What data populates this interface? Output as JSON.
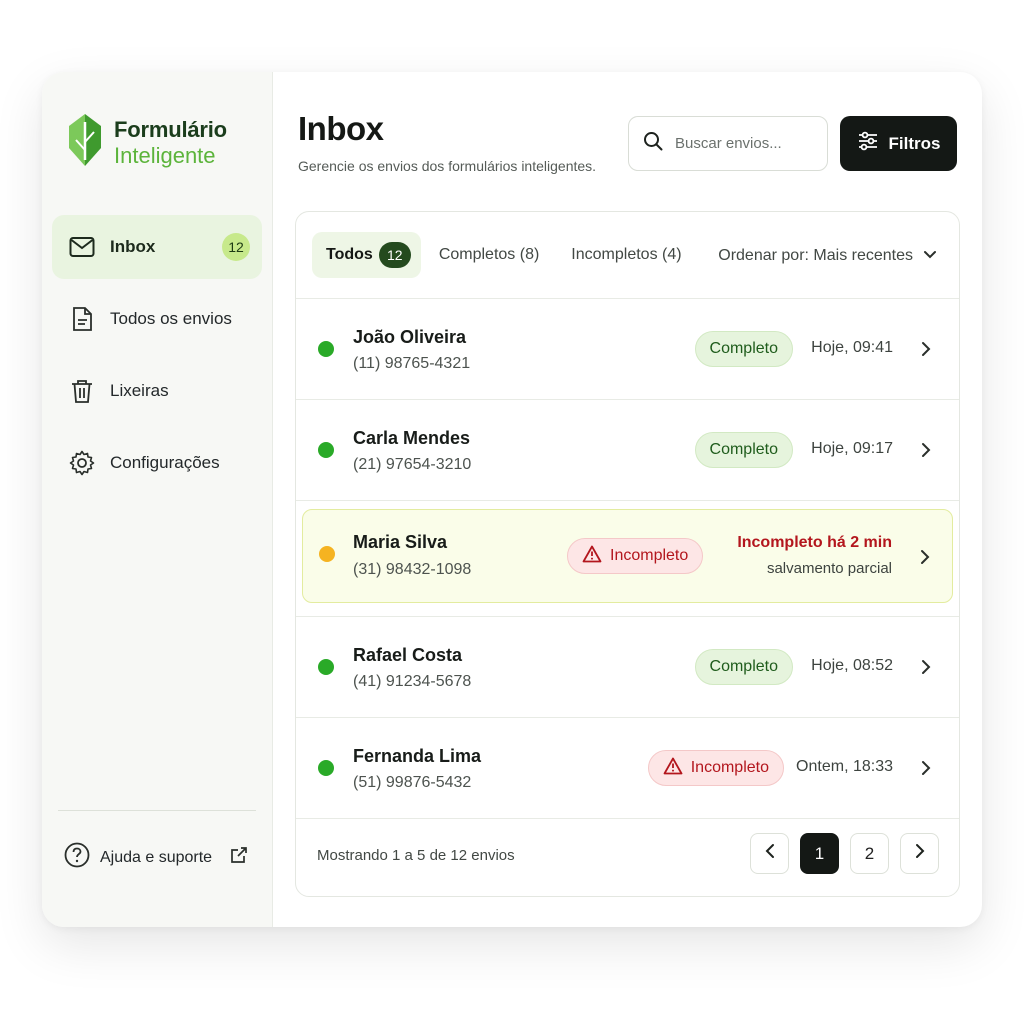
{
  "brand": {
    "line1": "Formulário",
    "line2": "Inteligente",
    "logo_icon": "leaf-logo-icon",
    "colors": {
      "dark": "#1b3d1c",
      "accent": "#5cb43b"
    }
  },
  "sidebar": {
    "items": [
      {
        "label": "Inbox",
        "icon": "mail-icon",
        "badge": "12",
        "active": true
      },
      {
        "label": "Todos os envios",
        "icon": "document-icon"
      },
      {
        "label": "Lixeiras",
        "icon": "trash-icon"
      },
      {
        "label": "Configurações",
        "icon": "gear-icon"
      }
    ],
    "help": {
      "label": "Ajuda e suporte",
      "icon": "help-circle-icon",
      "external_icon": "external-link-icon"
    }
  },
  "header": {
    "title": "Inbox",
    "subtitle": "Gerencie os envios dos formulários inteligentes.",
    "search_placeholder": "Buscar envios...",
    "filters_label": "Filtros"
  },
  "tabs": [
    {
      "label": "Todos",
      "count": "12",
      "active": true
    },
    {
      "label": "Completos (8)"
    },
    {
      "label": "Incompletos (4)"
    }
  ],
  "sort": {
    "label": "Ordenar por: Mais recentes"
  },
  "rows": [
    {
      "name": "João Oliveira",
      "phone": "(11) 98765-4321",
      "status": "Completo",
      "time": "Hoje, 09:41"
    },
    {
      "name": "Carla Mendes",
      "phone": "(21) 97654-3210",
      "status": "Completo",
      "time": "Hoje, 09:17"
    },
    {
      "name": "Maria Silva",
      "phone": "(31) 98432-1098",
      "status": "Incompleto",
      "alert": "Incompleto há 2 min",
      "note": "salvamento parcial"
    },
    {
      "name": "Rafael Costa",
      "phone": "(41) 91234-5678",
      "status": "Completo",
      "time": "Hoje, 08:52"
    },
    {
      "name": "Fernanda Lima",
      "phone": "(51) 99876-5432",
      "status": "Incompleto",
      "time": "Ontem, 18:33"
    }
  ],
  "footer": {
    "info": "Mostrando 1 a 5 de 12 envios",
    "pages": [
      "1",
      "2"
    ],
    "current_page": "1"
  },
  "colors": {
    "complete": "#2aaa28",
    "incomplete_dot": "#f5b321",
    "danger": "#b3161d",
    "dark": "#141815"
  }
}
